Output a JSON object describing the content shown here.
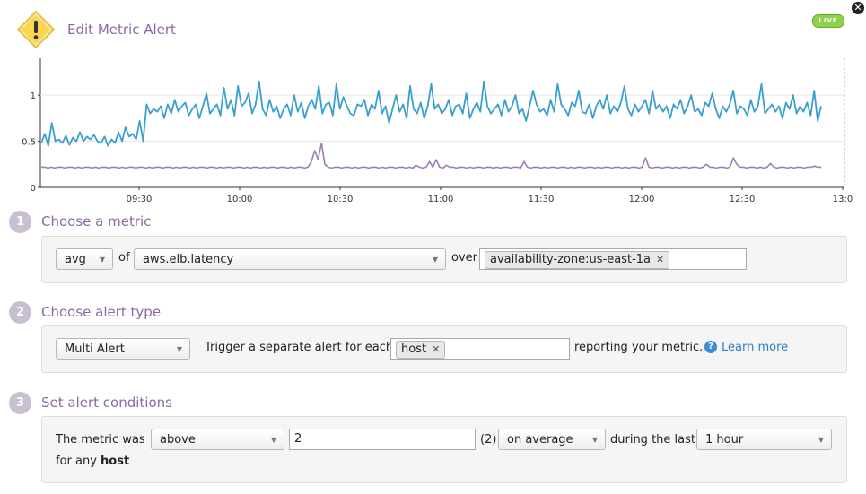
{
  "header": {
    "title": "Edit Metric Alert",
    "live_badge": "LIVE"
  },
  "chart_data": {
    "type": "line",
    "x_ticks": [
      "09:30",
      "10:00",
      "10:30",
      "11:00",
      "11:30",
      "12:00",
      "12:30",
      "13:0"
    ],
    "y_ticks": [
      "0",
      "0.5",
      "1"
    ],
    "ylim": [
      0,
      1.4
    ],
    "x_range_minutes": [
      0,
      240
    ],
    "series": [
      {
        "color": "#3a9fcf",
        "values": [
          0.48,
          0.58,
          0.45,
          0.7,
          0.5,
          0.52,
          0.48,
          0.56,
          0.46,
          0.54,
          0.5,
          0.6,
          0.5,
          0.55,
          0.52,
          0.57,
          0.5,
          0.48,
          0.55,
          0.45,
          0.52,
          0.48,
          0.6,
          0.5,
          0.65,
          0.55,
          0.58,
          0.52,
          0.72,
          0.5,
          0.9,
          0.8,
          0.85,
          0.82,
          0.88,
          0.75,
          0.9,
          0.8,
          0.95,
          0.82,
          0.88,
          0.92,
          0.78,
          0.85,
          0.9,
          0.75,
          0.88,
          1.02,
          0.8,
          0.85,
          0.9,
          0.78,
          1.08,
          0.85,
          0.95,
          0.78,
          1.1,
          0.88,
          0.92,
          1.02,
          0.8,
          0.9,
          1.15,
          0.85,
          0.78,
          0.95,
          0.82,
          0.88,
          0.75,
          0.85,
          0.9,
          0.78,
          1.0,
          0.82,
          0.92,
          0.75,
          0.88,
          0.95,
          0.85,
          1.1,
          0.8,
          0.9,
          0.92,
          0.78,
          1.12,
          0.85,
          0.98,
          0.88,
          0.8,
          0.78,
          0.9,
          0.88,
          0.95,
          0.78,
          0.9,
          0.85,
          1.05,
          0.8,
          0.88,
          0.7,
          0.85,
          1.0,
          0.82,
          0.9,
          0.75,
          1.1,
          0.85,
          0.8,
          0.92,
          0.75,
          0.88,
          1.12,
          0.85,
          0.9,
          0.8,
          0.85,
          0.95,
          0.78,
          0.88,
          0.9,
          0.8,
          1.02,
          0.75,
          0.85,
          0.92,
          0.82,
          1.15,
          0.88,
          0.8,
          0.85,
          0.9,
          0.78,
          0.95,
          0.82,
          0.88,
          1.0,
          0.8,
          0.85,
          0.72,
          0.88,
          1.05,
          0.9,
          0.82,
          0.85,
          0.78,
          0.95,
          0.82,
          1.12,
          0.9,
          0.85,
          0.78,
          0.92,
          0.88,
          1.05,
          0.82,
          0.8,
          0.9,
          0.75,
          0.88,
          0.95,
          0.85,
          1.0,
          0.8,
          0.88,
          0.82,
          0.92,
          1.1,
          0.85,
          0.78,
          0.9,
          0.82,
          0.88,
          0.95,
          0.8,
          1.05,
          0.85,
          0.9,
          0.82,
          0.88,
          0.75,
          0.9,
          0.85,
          0.95,
          0.8,
          0.88,
          1.0,
          0.82,
          0.85,
          0.78,
          0.92,
          0.88,
          1.02,
          0.85,
          0.75,
          0.88,
          0.82,
          0.9,
          1.05,
          0.8,
          0.88,
          0.85,
          0.78,
          0.95,
          0.82,
          0.88,
          1.12,
          0.8,
          0.85,
          0.9,
          0.82,
          0.88,
          0.75,
          0.92,
          0.85,
          1.0,
          0.8,
          0.88,
          0.82,
          0.92,
          0.78,
          1.05,
          0.72,
          0.88
        ]
      },
      {
        "color": "#9b80b8",
        "values": [
          0.22,
          0.22,
          0.21,
          0.22,
          0.21,
          0.22,
          0.22,
          0.21,
          0.22,
          0.22,
          0.21,
          0.22,
          0.21,
          0.22,
          0.22,
          0.21,
          0.22,
          0.21,
          0.22,
          0.22,
          0.21,
          0.22,
          0.22,
          0.21,
          0.22,
          0.21,
          0.22,
          0.22,
          0.21,
          0.22,
          0.22,
          0.21,
          0.22,
          0.21,
          0.22,
          0.22,
          0.21,
          0.22,
          0.22,
          0.21,
          0.22,
          0.21,
          0.22,
          0.22,
          0.21,
          0.22,
          0.21,
          0.22,
          0.22,
          0.21,
          0.22,
          0.22,
          0.21,
          0.22,
          0.21,
          0.22,
          0.22,
          0.21,
          0.22,
          0.22,
          0.21,
          0.22,
          0.21,
          0.22,
          0.22,
          0.21,
          0.22,
          0.21,
          0.22,
          0.22,
          0.21,
          0.22,
          0.22,
          0.21,
          0.22,
          0.21,
          0.22,
          0.22,
          0.21,
          0.22,
          0.28,
          0.4,
          0.3,
          0.48,
          0.25,
          0.22,
          0.21,
          0.22,
          0.22,
          0.21,
          0.22,
          0.22,
          0.21,
          0.22,
          0.21,
          0.22,
          0.22,
          0.21,
          0.22,
          0.22,
          0.21,
          0.22,
          0.21,
          0.22,
          0.22,
          0.21,
          0.22,
          0.22,
          0.21,
          0.22,
          0.21,
          0.24,
          0.22,
          0.21,
          0.22,
          0.28,
          0.22,
          0.3,
          0.22,
          0.21,
          0.24,
          0.22,
          0.22,
          0.21,
          0.22,
          0.22,
          0.21,
          0.22,
          0.21,
          0.22,
          0.22,
          0.21,
          0.22,
          0.22,
          0.21,
          0.22,
          0.21,
          0.22,
          0.22,
          0.21,
          0.22,
          0.22,
          0.21,
          0.28,
          0.22,
          0.21,
          0.22,
          0.22,
          0.21,
          0.22,
          0.21,
          0.22,
          0.22,
          0.21,
          0.22,
          0.22,
          0.21,
          0.22,
          0.21,
          0.22,
          0.22,
          0.21,
          0.22,
          0.22,
          0.21,
          0.22,
          0.21,
          0.22,
          0.22,
          0.21,
          0.22,
          0.22,
          0.21,
          0.22,
          0.21,
          0.22,
          0.22,
          0.21,
          0.22,
          0.32,
          0.22,
          0.21,
          0.22,
          0.22,
          0.21,
          0.22,
          0.22,
          0.21,
          0.22,
          0.21,
          0.22,
          0.22,
          0.21,
          0.22,
          0.22,
          0.21,
          0.22,
          0.25,
          0.22,
          0.22,
          0.21,
          0.22,
          0.22,
          0.21,
          0.22,
          0.32,
          0.25,
          0.22,
          0.22,
          0.21,
          0.22,
          0.22,
          0.21,
          0.22,
          0.21,
          0.22,
          0.26,
          0.22,
          0.21,
          0.22,
          0.22,
          0.21,
          0.22,
          0.21,
          0.22,
          0.22,
          0.21,
          0.22,
          0.22,
          0.23,
          0.22,
          0.22
        ]
      }
    ]
  },
  "step1": {
    "number": "1",
    "title": "Choose a metric",
    "aggregator": "avg",
    "of_label": "of",
    "metric": "aws.elb.latency",
    "over_label": "over",
    "scope_tag": "availability-zone:us-east-1a"
  },
  "step2": {
    "number": "2",
    "title": "Choose alert type",
    "alert_type": "Multi Alert",
    "trigger_label": "Trigger a separate alert for each",
    "group_tag": "host",
    "reporting_label": "reporting your metric.",
    "help_icon": "?",
    "learn_more": "Learn more"
  },
  "step3": {
    "number": "3",
    "title": "Set alert conditions",
    "metric_was_label": "The metric was",
    "comparator": "above",
    "threshold": "2",
    "threshold_note": "(2)",
    "aggregation": "on average",
    "during_label": "during the last",
    "timeframe": "1 hour",
    "for_any_label": "for any",
    "for_any_value": "host"
  },
  "icons": {
    "close": "✕",
    "tag_remove": "✕",
    "dropdown": "▼"
  }
}
